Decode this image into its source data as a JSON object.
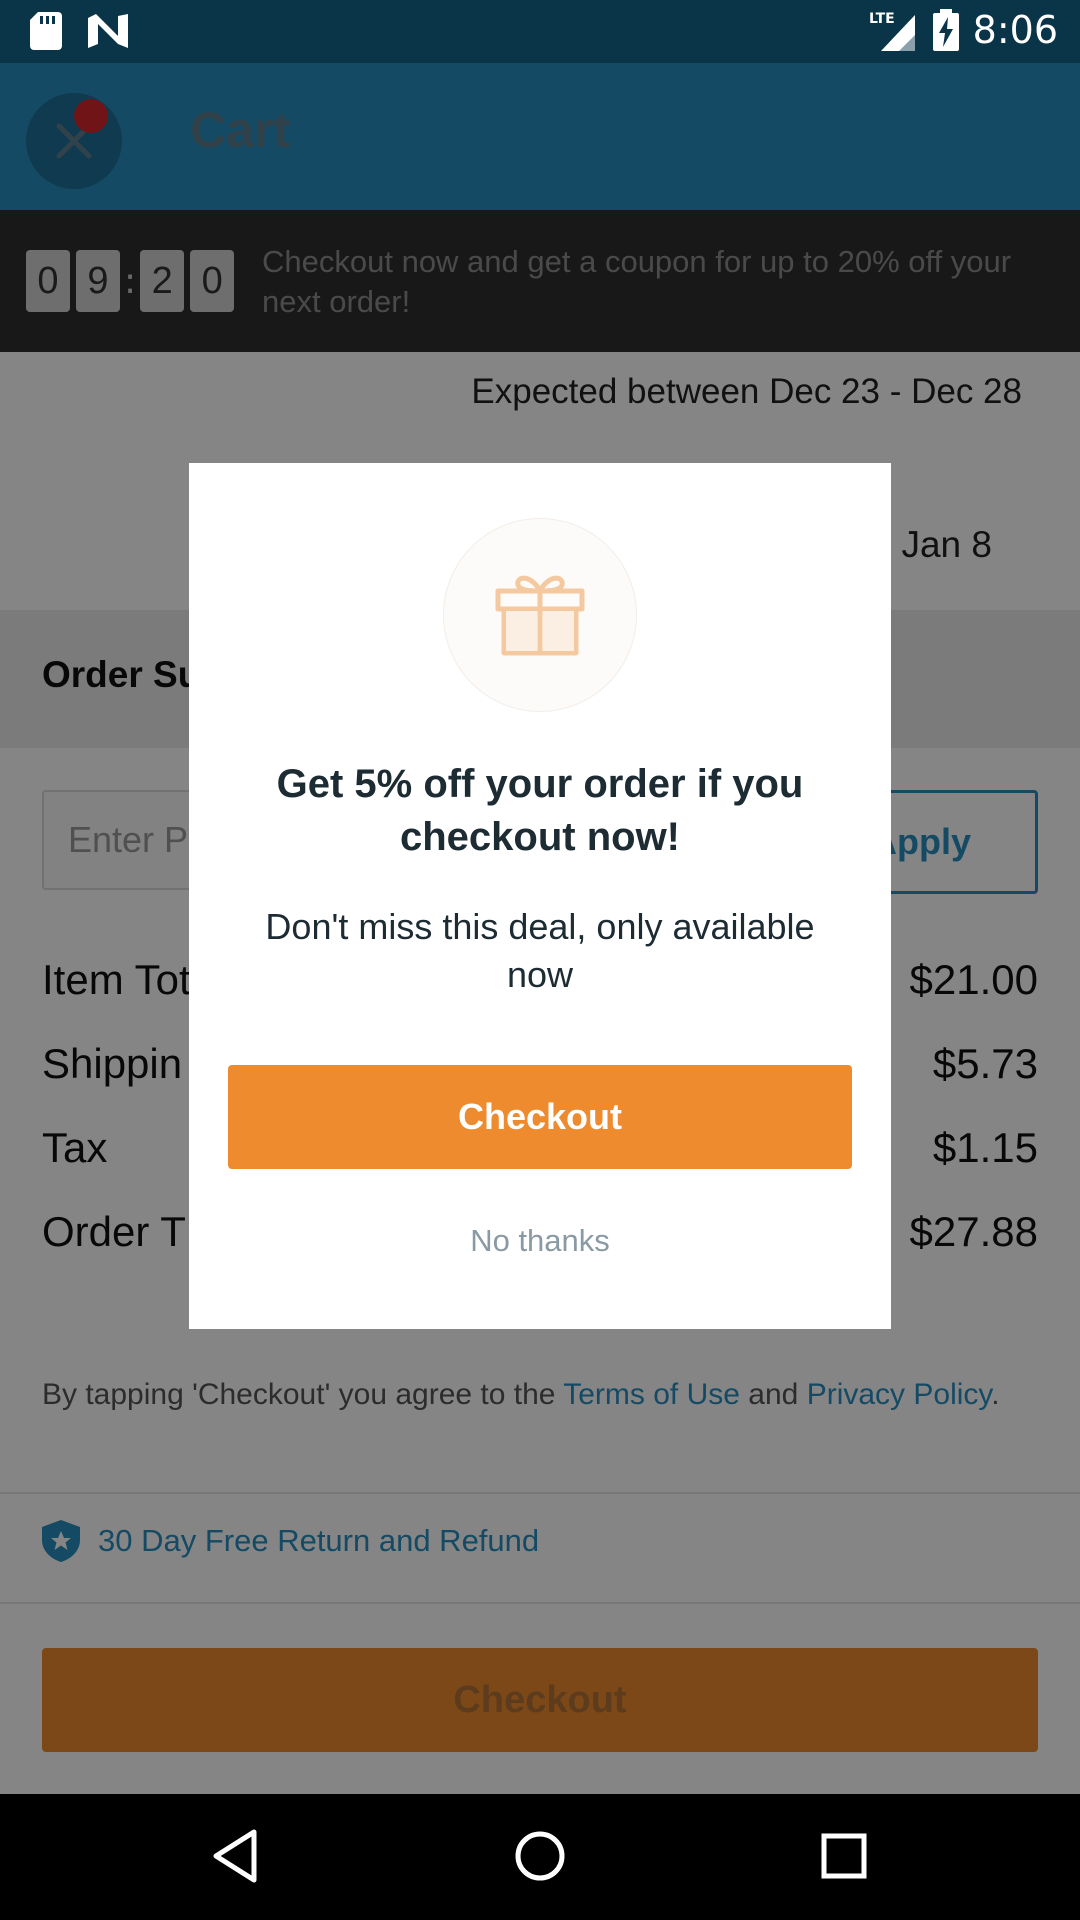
{
  "status_bar": {
    "time": "8:06",
    "network": "LTE",
    "icons": [
      "sd-card-icon",
      "n-notification-icon",
      "lte-signal-icon",
      "battery-charging-icon"
    ]
  },
  "app_bar": {
    "title": "Cart",
    "close_icon": "close-icon"
  },
  "timer_banner": {
    "digits": [
      "0",
      "9",
      "2",
      "0"
    ],
    "separator": ":",
    "message": "Checkout now and get a coupon for up to 20% off your next order!"
  },
  "cart": {
    "shipping_partial": "...ipping ...",
    "expected_1": "Expected between Dec 23 - Dec 28",
    "expected_2": "Jan 8"
  },
  "order_summary": {
    "title": "Order Su",
    "promo_placeholder": "Enter P",
    "apply_label": "Apply",
    "rows": [
      {
        "label": "Item Tot",
        "value": "$21.00"
      },
      {
        "label": "Shippin",
        "value": "$5.73"
      },
      {
        "label": "Tax",
        "value": "$1.15"
      },
      {
        "label": "Order T",
        "value": "$27.88"
      }
    ]
  },
  "terms": {
    "prefix": "By tapping 'Checkout' you agree to the ",
    "terms_link": "Terms of Use",
    "middle": " and ",
    "privacy_link": "Privacy Policy",
    "suffix": "."
  },
  "refund": {
    "icon": "shield-star-icon",
    "label": "30 Day Free Return and Refund"
  },
  "bottom_checkout_label": "Checkout",
  "dialog": {
    "icon": "gift-icon",
    "title": "Get 5% off your order if you checkout now!",
    "body": "Don't miss this deal, only available now",
    "checkout_label": "Checkout",
    "dismiss_label": "No thanks"
  },
  "nav_bar": {
    "buttons": [
      "back-icon",
      "home-icon",
      "recents-icon"
    ]
  },
  "colors": {
    "status_bar": "#0a3447",
    "app_bar": "#2a8fc1",
    "accent_orange": "#ee8b2e",
    "link_blue": "#2a8fc1",
    "banner": "#2f2f2f"
  }
}
